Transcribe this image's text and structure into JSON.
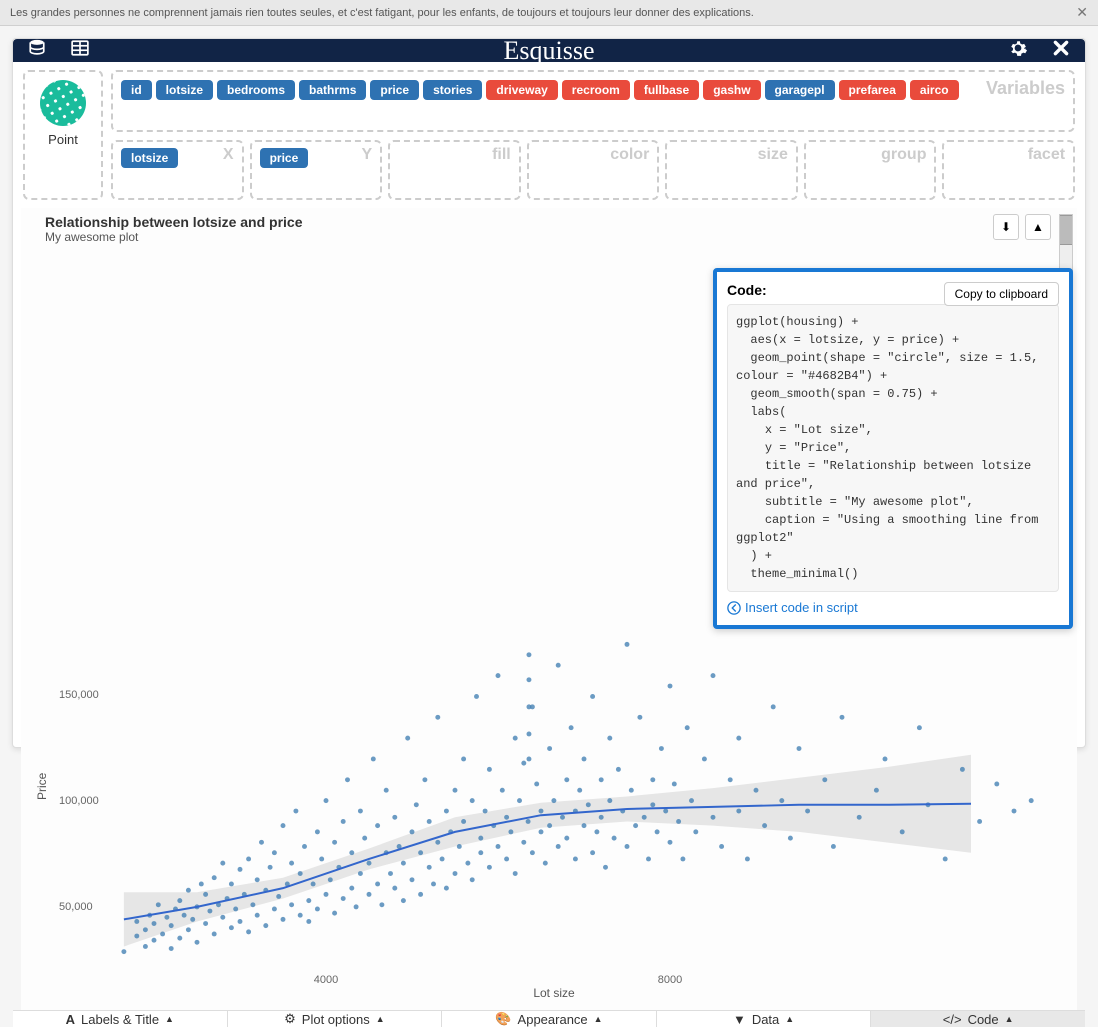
{
  "banner": {
    "text": "Les grandes personnes ne comprennent jamais rien toutes seules, et c'est fatigant, pour les enfants, de toujours et toujours leur donner des explications."
  },
  "app": {
    "title": "Esquisse"
  },
  "variables_label": "Variables",
  "geom": {
    "label": "Point"
  },
  "variables": [
    {
      "name": "id",
      "type": "blue"
    },
    {
      "name": "lotsize",
      "type": "blue"
    },
    {
      "name": "bedrooms",
      "type": "blue"
    },
    {
      "name": "bathrms",
      "type": "blue"
    },
    {
      "name": "price",
      "type": "blue"
    },
    {
      "name": "stories",
      "type": "blue"
    },
    {
      "name": "driveway",
      "type": "red"
    },
    {
      "name": "recroom",
      "type": "red"
    },
    {
      "name": "fullbase",
      "type": "red"
    },
    {
      "name": "gashw",
      "type": "red"
    },
    {
      "name": "garagepl",
      "type": "blue"
    },
    {
      "name": "prefarea",
      "type": "red"
    },
    {
      "name": "airco",
      "type": "red"
    }
  ],
  "aes": {
    "x": {
      "label": "X",
      "chips": [
        {
          "name": "lotsize",
          "type": "blue"
        }
      ]
    },
    "y": {
      "label": "Y",
      "chips": [
        {
          "name": "price",
          "type": "blue"
        }
      ]
    },
    "fill": {
      "label": "fill",
      "chips": []
    },
    "color": {
      "label": "color",
      "chips": []
    },
    "size": {
      "label": "size",
      "chips": []
    },
    "group": {
      "label": "group",
      "chips": []
    },
    "facet": {
      "label": "facet",
      "chips": []
    }
  },
  "plot": {
    "title": "Relationship between lotsize and price",
    "subtitle": "My awesome plot",
    "xlabel": "Lot size",
    "ylabel": "Price"
  },
  "code_panel": {
    "heading": "Code:",
    "copy_btn": "Copy to clipboard",
    "code": "ggplot(housing) +\n  aes(x = lotsize, y = price) +\n  geom_point(shape = \"circle\", size = 1.5, colour = \"#4682B4\") +\n  geom_smooth(span = 0.75) +\n  labs(\n    x = \"Lot size\",\n    y = \"Price\",\n    title = \"Relationship between lotsize and price\",\n    subtitle = \"My awesome plot\",\n    caption = \"Using a smoothing line from ggplot2\"\n  ) +\n  theme_minimal()",
    "insert_link": "Insert code in script"
  },
  "tabs": {
    "labels_title": "Labels & Title",
    "plot_options": "Plot options",
    "appearance": "Appearance",
    "data": "Data",
    "code": "Code"
  },
  "chart_data": {
    "type": "scatter",
    "title": "Relationship between lotsize and price",
    "subtitle": "My awesome plot",
    "xlabel": "Lot size",
    "ylabel": "Price",
    "x_ticks": [
      4000,
      8000
    ],
    "y_ticks": [
      50000,
      100000,
      150000
    ],
    "xlim": [
      1500,
      12500
    ],
    "ylim": [
      20000,
      195000
    ],
    "point_color": "#4682B4",
    "smooth": {
      "x": [
        1650,
        2500,
        3500,
        4500,
        5500,
        6500,
        7500,
        8500,
        9500,
        10500,
        11500
      ],
      "y": [
        43000,
        49000,
        58000,
        72000,
        85000,
        93000,
        96000,
        97000,
        98000,
        98000,
        98500
      ],
      "lo": [
        30000,
        42000,
        53000,
        67000,
        78000,
        87000,
        90000,
        88000,
        85000,
        80000,
        75000
      ],
      "hi": [
        56000,
        56000,
        63000,
        77000,
        92000,
        99000,
        102000,
        106000,
        111000,
        116000,
        122000
      ]
    },
    "points": [
      [
        1650,
        27500
      ],
      [
        1800,
        35000
      ],
      [
        1800,
        42000
      ],
      [
        1900,
        30000
      ],
      [
        1900,
        38000
      ],
      [
        1950,
        45000
      ],
      [
        2000,
        33000
      ],
      [
        2000,
        41000
      ],
      [
        2050,
        50000
      ],
      [
        2100,
        36000
      ],
      [
        2150,
        44000
      ],
      [
        2200,
        29000
      ],
      [
        2200,
        40000
      ],
      [
        2250,
        48000
      ],
      [
        2300,
        34000
      ],
      [
        2300,
        52000
      ],
      [
        2350,
        45000
      ],
      [
        2400,
        38000
      ],
      [
        2400,
        57000
      ],
      [
        2450,
        43000
      ],
      [
        2500,
        32000
      ],
      [
        2500,
        49000
      ],
      [
        2550,
        60000
      ],
      [
        2600,
        41000
      ],
      [
        2600,
        55000
      ],
      [
        2650,
        47000
      ],
      [
        2700,
        36000
      ],
      [
        2700,
        63000
      ],
      [
        2750,
        50000
      ],
      [
        2800,
        44000
      ],
      [
        2800,
        70000
      ],
      [
        2850,
        53000
      ],
      [
        2900,
        39000
      ],
      [
        2900,
        60000
      ],
      [
        2950,
        48000
      ],
      [
        3000,
        42000
      ],
      [
        3000,
        67000
      ],
      [
        3050,
        55000
      ],
      [
        3100,
        37000
      ],
      [
        3100,
        72000
      ],
      [
        3150,
        50000
      ],
      [
        3200,
        45000
      ],
      [
        3200,
        62000
      ],
      [
        3250,
        80000
      ],
      [
        3300,
        40000
      ],
      [
        3300,
        57000
      ],
      [
        3350,
        68000
      ],
      [
        3400,
        48000
      ],
      [
        3400,
        75000
      ],
      [
        3450,
        54000
      ],
      [
        3500,
        43000
      ],
      [
        3500,
        88000
      ],
      [
        3550,
        60000
      ],
      [
        3600,
        50000
      ],
      [
        3600,
        70000
      ],
      [
        3650,
        95000
      ],
      [
        3700,
        45000
      ],
      [
        3700,
        65000
      ],
      [
        3750,
        78000
      ],
      [
        3800,
        52000
      ],
      [
        3800,
        42000
      ],
      [
        3850,
        60000
      ],
      [
        3900,
        85000
      ],
      [
        3900,
        48000
      ],
      [
        3950,
        72000
      ],
      [
        4000,
        55000
      ],
      [
        4000,
        100000
      ],
      [
        4050,
        62000
      ],
      [
        4100,
        46000
      ],
      [
        4100,
        80000
      ],
      [
        4150,
        68000
      ],
      [
        4200,
        53000
      ],
      [
        4200,
        90000
      ],
      [
        4250,
        110000
      ],
      [
        4300,
        58000
      ],
      [
        4300,
        75000
      ],
      [
        4350,
        49000
      ],
      [
        4400,
        65000
      ],
      [
        4400,
        95000
      ],
      [
        4450,
        82000
      ],
      [
        4500,
        55000
      ],
      [
        4500,
        70000
      ],
      [
        4550,
        120000
      ],
      [
        4600,
        60000
      ],
      [
        4600,
        88000
      ],
      [
        4650,
        50000
      ],
      [
        4700,
        75000
      ],
      [
        4700,
        105000
      ],
      [
        4750,
        65000
      ],
      [
        4800,
        58000
      ],
      [
        4800,
        92000
      ],
      [
        4850,
        78000
      ],
      [
        4900,
        52000
      ],
      [
        4900,
        70000
      ],
      [
        4950,
        130000
      ],
      [
        5000,
        62000
      ],
      [
        5000,
        85000
      ],
      [
        5050,
        98000
      ],
      [
        5100,
        55000
      ],
      [
        5100,
        75000
      ],
      [
        5150,
        110000
      ],
      [
        5200,
        68000
      ],
      [
        5200,
        90000
      ],
      [
        5250,
        60000
      ],
      [
        5300,
        80000
      ],
      [
        5300,
        140000
      ],
      [
        5350,
        72000
      ],
      [
        5400,
        95000
      ],
      [
        5400,
        58000
      ],
      [
        5450,
        85000
      ],
      [
        5500,
        65000
      ],
      [
        5500,
        105000
      ],
      [
        5550,
        78000
      ],
      [
        5600,
        90000
      ],
      [
        5600,
        120000
      ],
      [
        5650,
        70000
      ],
      [
        5700,
        62000
      ],
      [
        5700,
        100000
      ],
      [
        5750,
        150000
      ],
      [
        5800,
        82000
      ],
      [
        5800,
        75000
      ],
      [
        5850,
        95000
      ],
      [
        5900,
        68000
      ],
      [
        5900,
        115000
      ],
      [
        5950,
        88000
      ],
      [
        6000,
        78000
      ],
      [
        6000,
        160000
      ],
      [
        6050,
        105000
      ],
      [
        6100,
        72000
      ],
      [
        6100,
        92000
      ],
      [
        6150,
        85000
      ],
      [
        6200,
        130000
      ],
      [
        6200,
        65000
      ],
      [
        6250,
        100000
      ],
      [
        6300,
        80000
      ],
      [
        6300,
        118000
      ],
      [
        6350,
        90000
      ],
      [
        6400,
        75000
      ],
      [
        6400,
        145000
      ],
      [
        6450,
        108000
      ],
      [
        6500,
        85000
      ],
      [
        6500,
        95000
      ],
      [
        6550,
        70000
      ],
      [
        6600,
        125000
      ],
      [
        6600,
        88000
      ],
      [
        6650,
        100000
      ],
      [
        6700,
        78000
      ],
      [
        6700,
        165000
      ],
      [
        6750,
        92000
      ],
      [
        6800,
        110000
      ],
      [
        6800,
        82000
      ],
      [
        6850,
        135000
      ],
      [
        6900,
        95000
      ],
      [
        6900,
        72000
      ],
      [
        6950,
        105000
      ],
      [
        7000,
        88000
      ],
      [
        7000,
        120000
      ],
      [
        7050,
        98000
      ],
      [
        7100,
        75000
      ],
      [
        7100,
        150000
      ],
      [
        7150,
        85000
      ],
      [
        7200,
        110000
      ],
      [
        7200,
        92000
      ],
      [
        7250,
        68000
      ],
      [
        7300,
        100000
      ],
      [
        7300,
        130000
      ],
      [
        7350,
        82000
      ],
      [
        7400,
        115000
      ],
      [
        7450,
        95000
      ],
      [
        7500,
        78000
      ],
      [
        7500,
        175000
      ],
      [
        7550,
        105000
      ],
      [
        7600,
        88000
      ],
      [
        7650,
        140000
      ],
      [
        7700,
        92000
      ],
      [
        7750,
        72000
      ],
      [
        7800,
        110000
      ],
      [
        7800,
        98000
      ],
      [
        7850,
        85000
      ],
      [
        7900,
        125000
      ],
      [
        7950,
        95000
      ],
      [
        8000,
        80000
      ],
      [
        8000,
        155000
      ],
      [
        8050,
        108000
      ],
      [
        8100,
        90000
      ],
      [
        8150,
        72000
      ],
      [
        8200,
        135000
      ],
      [
        8250,
        100000
      ],
      [
        8300,
        85000
      ],
      [
        8400,
        120000
      ],
      [
        8500,
        92000
      ],
      [
        8500,
        160000
      ],
      [
        8600,
        78000
      ],
      [
        8700,
        110000
      ],
      [
        8800,
        130000
      ],
      [
        8800,
        95000
      ],
      [
        8900,
        72000
      ],
      [
        9000,
        105000
      ],
      [
        9000,
        190000
      ],
      [
        9100,
        88000
      ],
      [
        9200,
        145000
      ],
      [
        9300,
        100000
      ],
      [
        9400,
        82000
      ],
      [
        9500,
        125000
      ],
      [
        9600,
        95000
      ],
      [
        9800,
        110000
      ],
      [
        9900,
        78000
      ],
      [
        10000,
        140000
      ],
      [
        10200,
        92000
      ],
      [
        10400,
        105000
      ],
      [
        10500,
        120000
      ],
      [
        10700,
        85000
      ],
      [
        10900,
        135000
      ],
      [
        11000,
        98000
      ],
      [
        11200,
        72000
      ],
      [
        11400,
        115000
      ],
      [
        11600,
        90000
      ],
      [
        11800,
        108000
      ],
      [
        12000,
        95000
      ],
      [
        12200,
        100000
      ],
      [
        6360,
        120000
      ],
      [
        6360,
        132000
      ],
      [
        6360,
        145000
      ],
      [
        6360,
        158000
      ],
      [
        6360,
        170000
      ]
    ]
  }
}
